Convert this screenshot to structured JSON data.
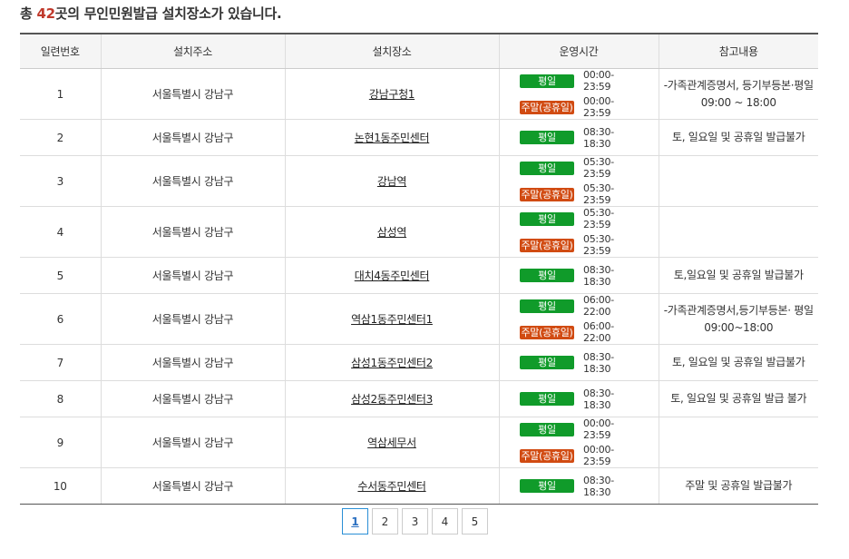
{
  "summary": {
    "prefix": "총 ",
    "count": "42",
    "suffix": "곳의 무인민원발급 설치장소가 있습니다."
  },
  "columns": [
    "일련번호",
    "설치주소",
    "설치장소",
    "운영시간",
    "참고내용"
  ],
  "badges": {
    "weekday": "평일",
    "weekend": "주말(공휴일)"
  },
  "rows": [
    {
      "no": "1",
      "address": "서울특별시 강남구",
      "place": "강남구청1",
      "hours": [
        {
          "type": "weekday",
          "time": "00:00-23:59"
        },
        {
          "type": "weekend",
          "time": "00:00-23:59"
        }
      ],
      "note": "-가족관계증명서, 등기부등본·평일 09:00 ~ 18:00"
    },
    {
      "no": "2",
      "address": "서울특별시 강남구",
      "place": "논현1동주민센터",
      "hours": [
        {
          "type": "weekday",
          "time": "08:30-18:30"
        }
      ],
      "note": "토, 일요일 및 공휴일 발급불가"
    },
    {
      "no": "3",
      "address": "서울특별시 강남구",
      "place": "강남역",
      "hours": [
        {
          "type": "weekday",
          "time": "05:30-23:59"
        },
        {
          "type": "weekend",
          "time": "05:30-23:59"
        }
      ],
      "note": ""
    },
    {
      "no": "4",
      "address": "서울특별시 강남구",
      "place": "삼성역",
      "hours": [
        {
          "type": "weekday",
          "time": "05:30-23:59"
        },
        {
          "type": "weekend",
          "time": "05:30-23:59"
        }
      ],
      "note": ""
    },
    {
      "no": "5",
      "address": "서울특별시 강남구",
      "place": "대치4동주민센터",
      "hours": [
        {
          "type": "weekday",
          "time": "08:30-18:30"
        }
      ],
      "note": "토,일요일 및 공휴일 발급불가"
    },
    {
      "no": "6",
      "address": "서울특별시 강남구",
      "place": "역삼1동주민센터1",
      "hours": [
        {
          "type": "weekday",
          "time": "06:00-22:00"
        },
        {
          "type": "weekend",
          "time": "06:00-22:00"
        }
      ],
      "note": "-가족관계증명서,등기부등본· 평일 09:00~18:00"
    },
    {
      "no": "7",
      "address": "서울특별시 강남구",
      "place": "삼성1동주민센터2",
      "hours": [
        {
          "type": "weekday",
          "time": "08:30-18:30"
        }
      ],
      "note": "토, 일요일 및 공휴일 발급불가"
    },
    {
      "no": "8",
      "address": "서울특별시 강남구",
      "place": "삼성2동주민센터3",
      "hours": [
        {
          "type": "weekday",
          "time": "08:30-18:30"
        }
      ],
      "note": "토, 일요일 및 공휴일 발급 불가"
    },
    {
      "no": "9",
      "address": "서울특별시 강남구",
      "place": "역삼세무서",
      "hours": [
        {
          "type": "weekday",
          "time": "00:00-23:59"
        },
        {
          "type": "weekend",
          "time": "00:00-23:59"
        }
      ],
      "note": ""
    },
    {
      "no": "10",
      "address": "서울특별시 강남구",
      "place": "수서동주민센터",
      "hours": [
        {
          "type": "weekday",
          "time": "08:30-18:30"
        }
      ],
      "note": "주말 및 공휴일 발급불가"
    }
  ],
  "pagination": {
    "pages": [
      "1",
      "2",
      "3",
      "4",
      "5"
    ],
    "current": "1"
  },
  "colors": {
    "count": "#c0392b",
    "weekday_badge": "#109b2a",
    "weekend_badge": "#d14b12",
    "active_page": "#2a8fd6"
  }
}
